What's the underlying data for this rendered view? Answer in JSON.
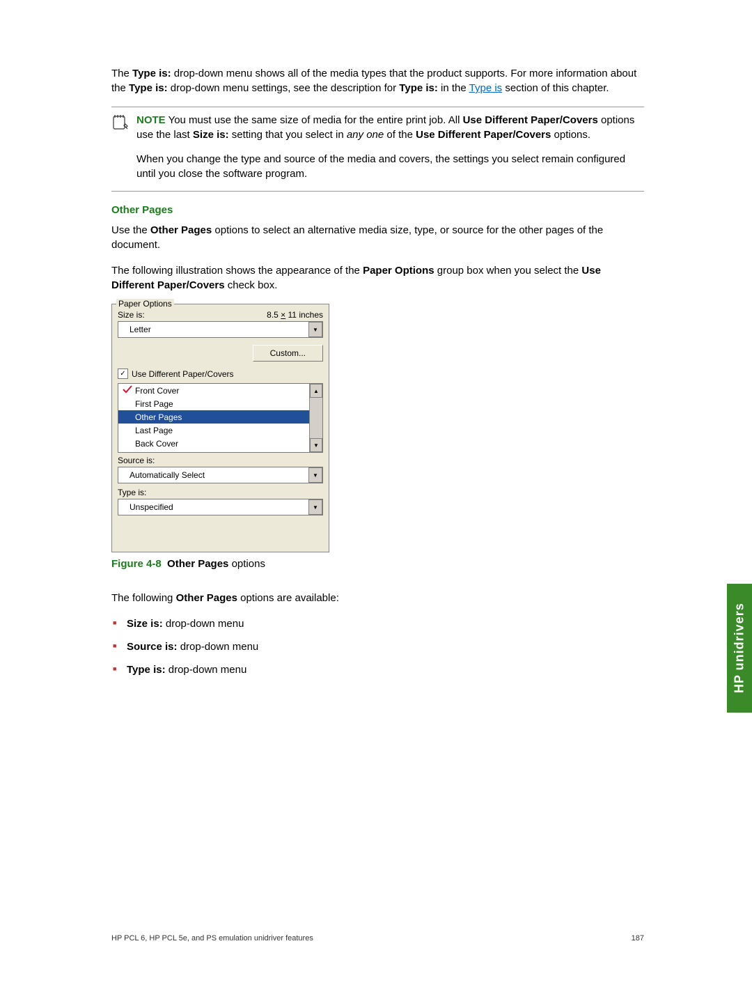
{
  "intro": {
    "before_link": "The ",
    "type_is_bold": "Type is:",
    "after_type": " drop-down menu shows all of the media types that the product supports. For more information about the ",
    "type_is_bold2": "Type is:",
    "after_type2": " drop-down menu settings, see the description for ",
    "type_is_bold3": "Type is:",
    "after_type3": " in the ",
    "link_text": "Type is",
    "after_link": " section of this chapter."
  },
  "note": {
    "label": "NOTE",
    "p1_a": "   You must use the same size of media for the entire print job. All ",
    "p1_b": "Use Different Paper/Covers",
    "p1_c": " options use the last ",
    "p1_d": "Size is:",
    "p1_e": " setting that you select in ",
    "p1_f_i": "any one",
    "p1_g": " of the ",
    "p1_h": "Use Different Paper/Covers",
    "p1_i": " options.",
    "p2": "When you change the type and source of the media and covers, the settings you select remain configured until you close the software program."
  },
  "h_other": "Other Pages",
  "use_para_a": "Use the ",
  "use_b": "Other Pages",
  "use_para_b": " options to select an alternative media size, type, or source for the other pages of the document.",
  "illus_a": "The following illustration shows the appearance of the ",
  "illus_b": "Paper Options",
  "illus_c": " group box when you select the ",
  "illus_d": "Use Different Paper/Covers",
  "illus_e": " check box.",
  "paperopts": {
    "legend": "Paper Options",
    "size_label": "Size is:",
    "dim": "8.5 × 11 inches",
    "size_value": "Letter",
    "custom_btn": "Custom...",
    "checkbox_label": "Use Different Paper/Covers",
    "list": [
      "Front Cover",
      "First Page",
      "Other Pages",
      "Last Page",
      "Back Cover"
    ],
    "source_label": "Source is:",
    "source_value": "Automatically Select",
    "type_label": "Type is:",
    "type_value": "Unspecified"
  },
  "figure": {
    "num": "Figure 4-8",
    "title": "Other Pages",
    "suffix": " options"
  },
  "avail_a": "The following ",
  "avail_b": "Other Pages",
  "avail_c": " options are available:",
  "bullets": [
    {
      "b": "Size is:",
      "t": " drop-down menu"
    },
    {
      "b": "Source is:",
      "t": " drop-down menu"
    },
    {
      "b": "Type is:",
      "t": " drop-down menu"
    }
  ],
  "side_tab": "HP unidrivers",
  "footer_left": "HP PCL 6, HP PCL 5e, and PS emulation unidriver features",
  "footer_right": "187"
}
